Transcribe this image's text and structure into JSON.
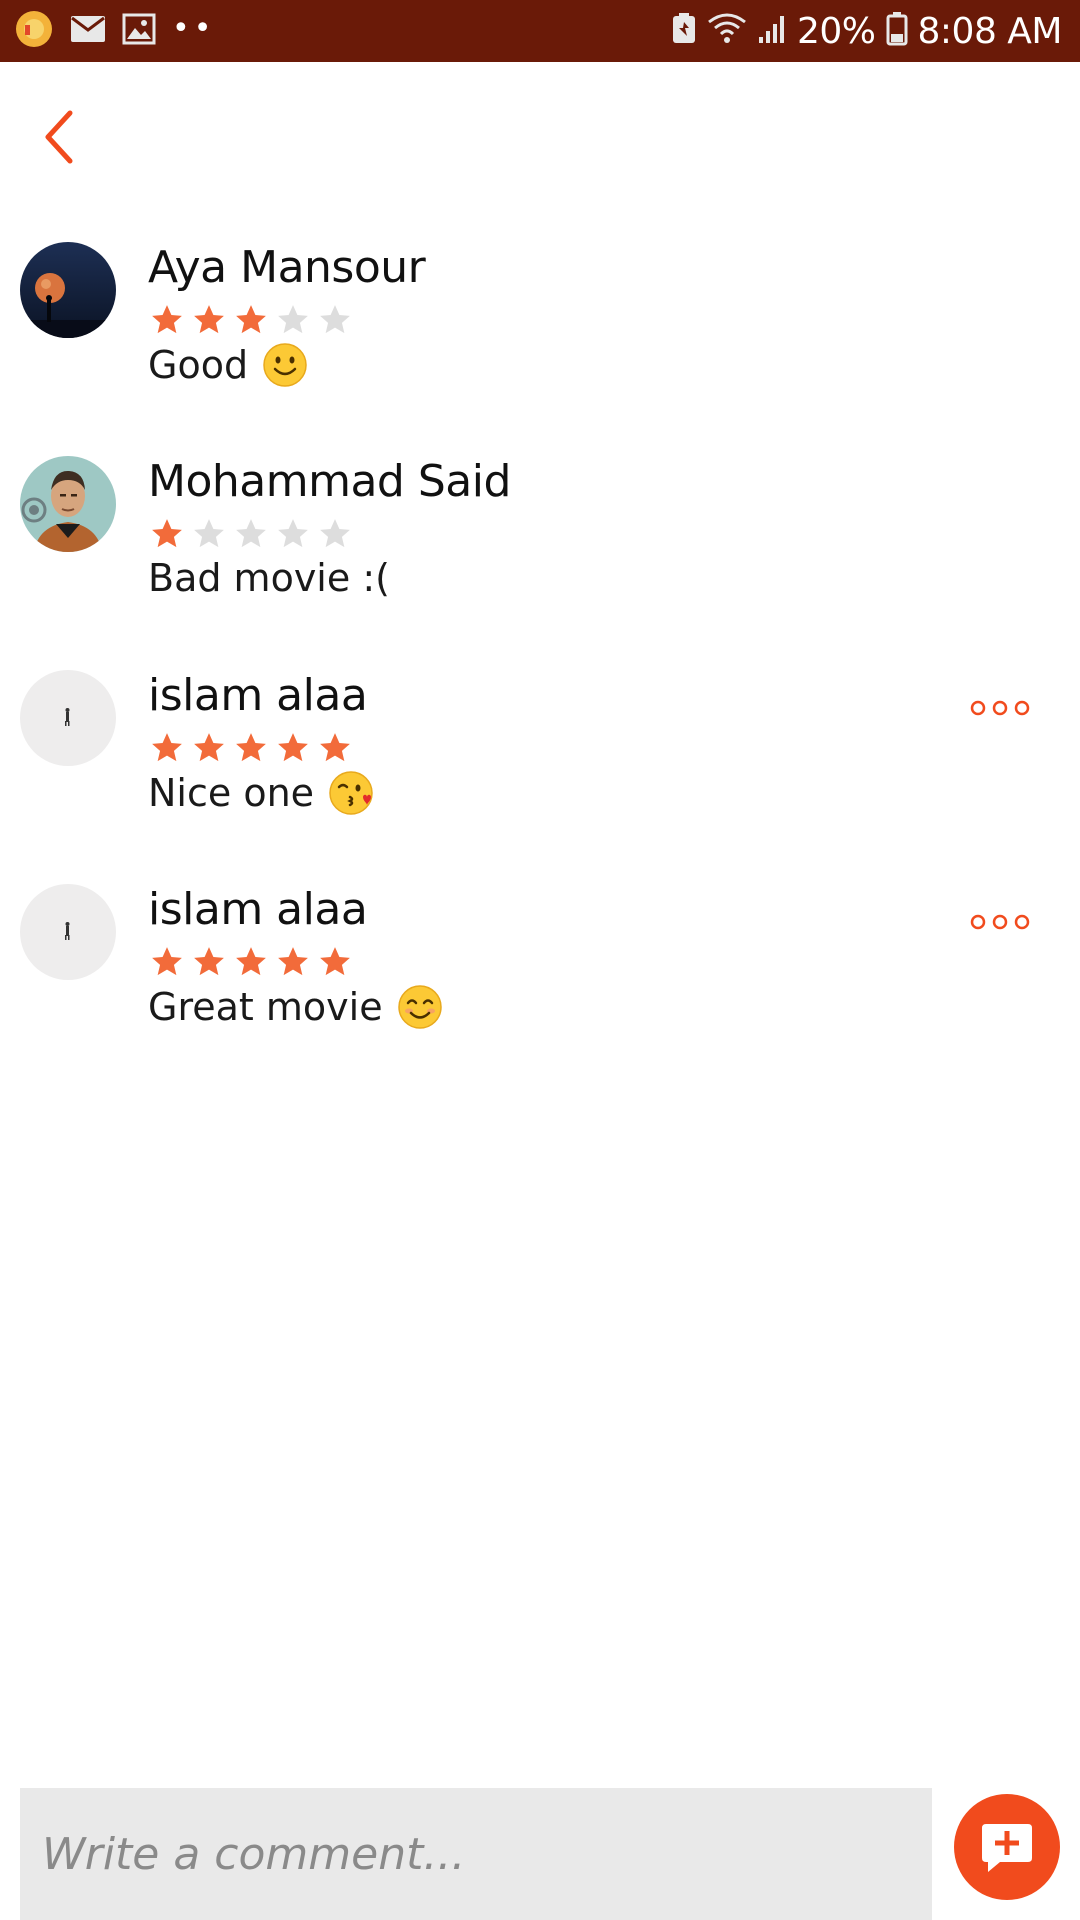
{
  "status_bar": {
    "battery_percent": "20%",
    "time": "8:08 AM",
    "left_icons": [
      "app-notification-icon",
      "mail-icon",
      "image-icon"
    ],
    "right_icons": [
      "battery-saver-icon",
      "wifi-icon",
      "signal-icon",
      "battery-icon"
    ]
  },
  "header": {
    "back_icon": "chevron-left-icon"
  },
  "colors": {
    "accent": "#F14B1D",
    "star_filled": "#F26B3A",
    "star_empty": "#DDDDDD",
    "status_bar": "#6A1A08"
  },
  "comments": [
    {
      "author": "Aya Mansour",
      "rating": 3,
      "text": "Good",
      "emoji": "slightly-smiling-face",
      "has_more": false
    },
    {
      "author": "Mohammad Said",
      "rating": 1,
      "text": "Bad movie :(",
      "emoji": "",
      "has_more": false
    },
    {
      "author": "islam alaa",
      "rating": 5,
      "text": "Nice one",
      "emoji": "face-blowing-kiss",
      "has_more": true
    },
    {
      "author": "islam alaa",
      "rating": 5,
      "text": "Great movie",
      "emoji": "smiling-face-with-smiling-eyes",
      "has_more": true
    }
  ],
  "composer": {
    "placeholder": "Write a comment...",
    "value": "",
    "submit_icon": "add-comment-icon"
  }
}
